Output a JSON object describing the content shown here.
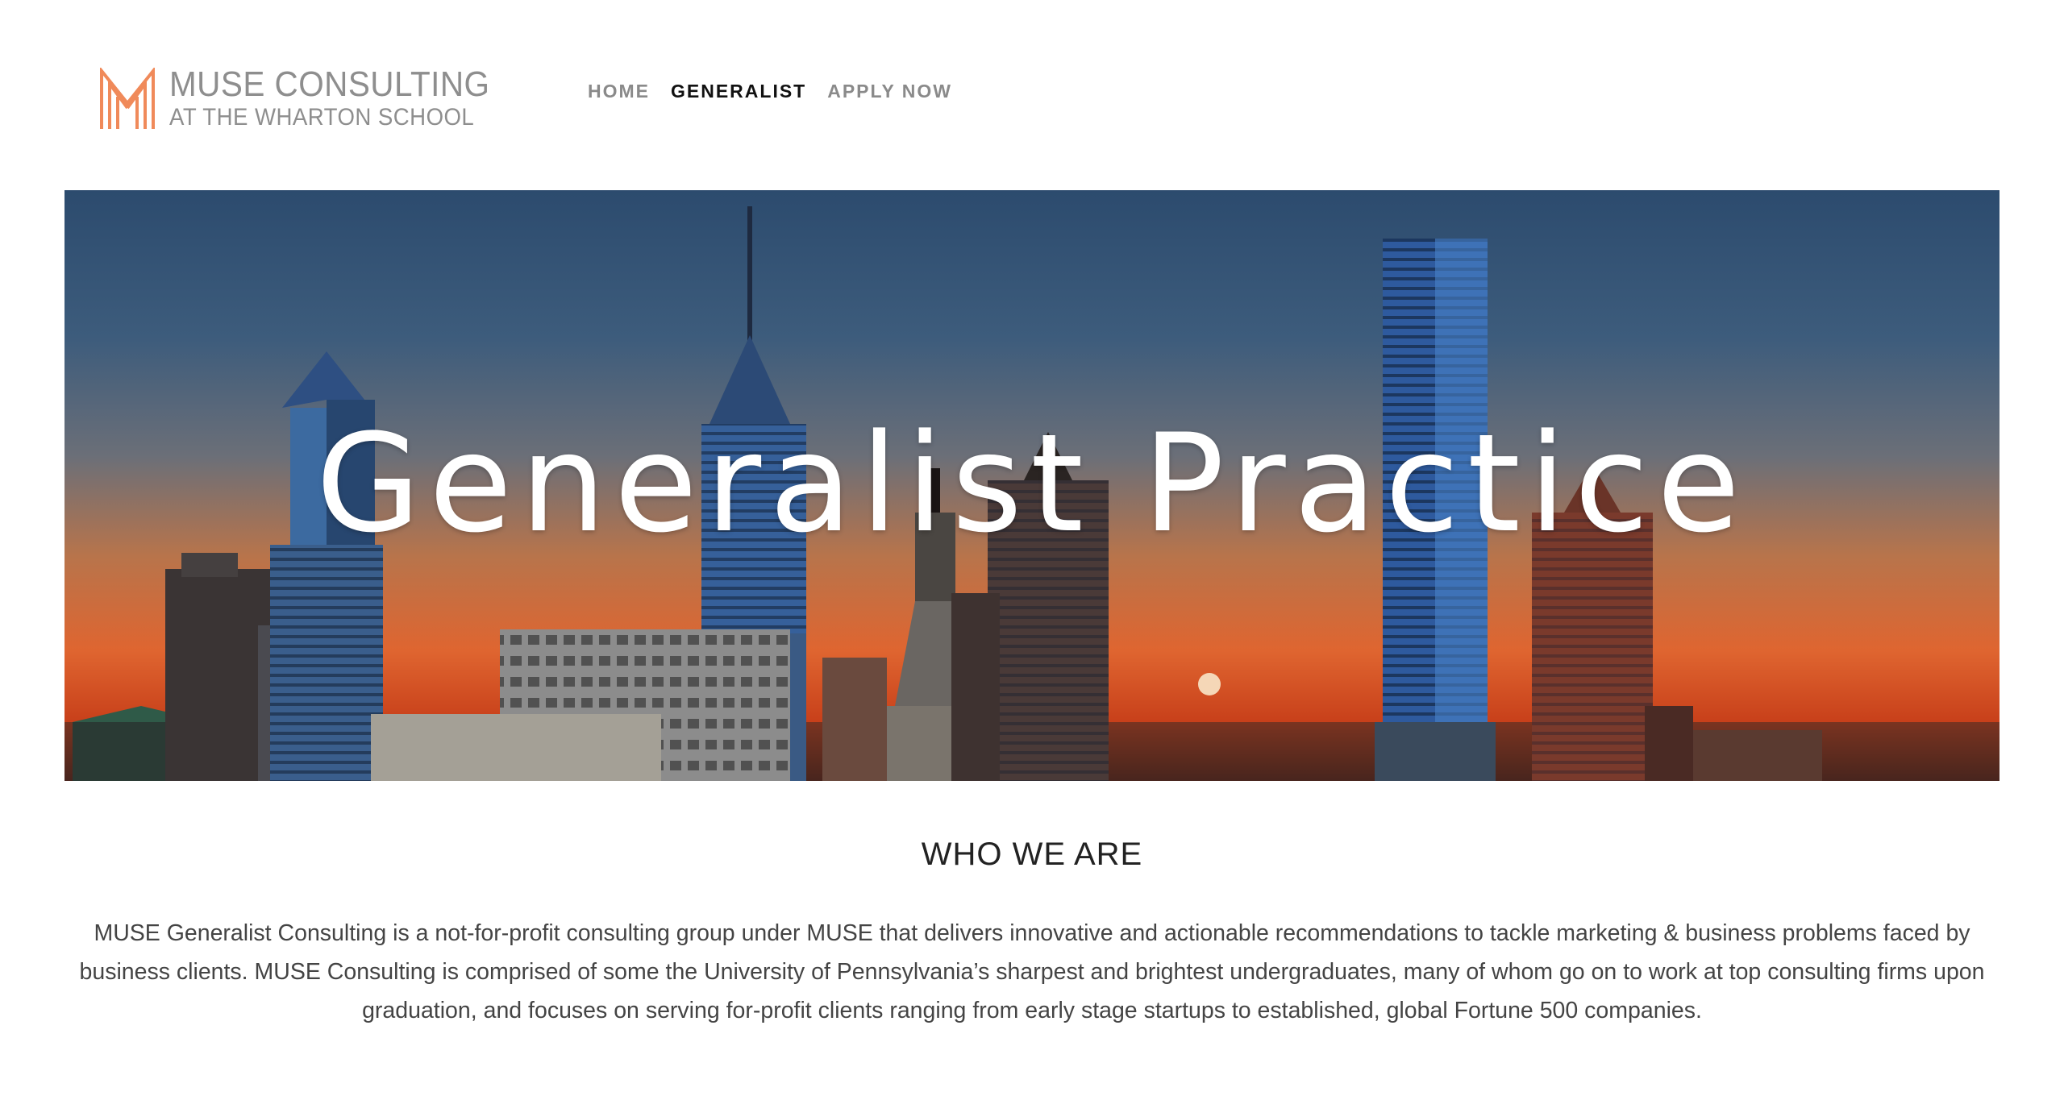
{
  "logo": {
    "line1": "MUSE CONSULTING",
    "line2": "AT THE WHARTON SCHOOL",
    "accent_color": "#f08a5a"
  },
  "nav": {
    "items": [
      {
        "label": "HOME",
        "active": false
      },
      {
        "label": "GENERALIST",
        "active": true
      },
      {
        "label": "APPLY NOW",
        "active": false
      }
    ]
  },
  "hero": {
    "title": "Generalist Practice",
    "image": "philadelphia-skyline-sunset"
  },
  "about": {
    "heading": "WHO WE ARE",
    "body": "MUSE Generalist Consulting is a not-for-profit consulting group under MUSE that delivers innovative and actionable recommendations to tackle marketing & business problems faced by business clients. MUSE Consulting is comprised of some the University of Pennsylvania’s sharpest and brightest undergraduates, many of whom go on to work at top consulting firms upon graduation, and focuses on serving for-profit clients ranging from early stage startups to established, global Fortune 500 companies."
  }
}
